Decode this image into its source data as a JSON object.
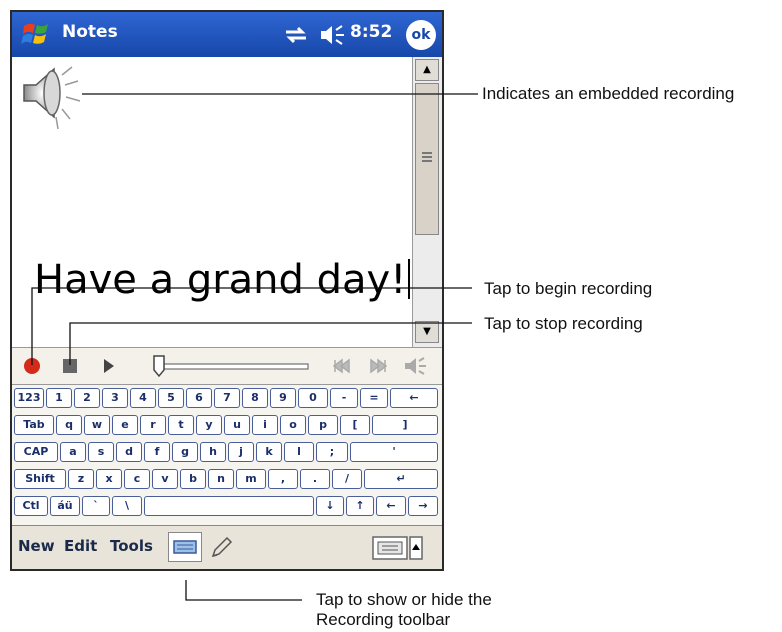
{
  "titlebar": {
    "app_title": "Notes",
    "time": "8:52",
    "ok_label": "ok"
  },
  "note": {
    "text": "Have a grand day!"
  },
  "keyboard": {
    "rows": [
      [
        "123",
        "1",
        "2",
        "3",
        "4",
        "5",
        "6",
        "7",
        "8",
        "9",
        "0",
        "-",
        "=",
        "←"
      ],
      [
        "Tab",
        "q",
        "w",
        "e",
        "r",
        "t",
        "y",
        "u",
        "i",
        "o",
        "p",
        "[",
        "]"
      ],
      [
        "CAP",
        "a",
        "s",
        "d",
        "f",
        "g",
        "h",
        "j",
        "k",
        "l",
        ";",
        "'"
      ],
      [
        "Shift",
        "z",
        "x",
        "c",
        "v",
        "b",
        "n",
        "m",
        ",",
        ".",
        "/",
        "↵"
      ],
      [
        "Ctl",
        "áü",
        "`",
        "\\",
        " ",
        "↓",
        "↑",
        "←",
        "→"
      ]
    ]
  },
  "menubar": {
    "new": "New",
    "edit": "Edit",
    "tools": "Tools"
  },
  "callouts": {
    "embedded": "Indicates an embedded recording",
    "begin": "Tap to begin recording",
    "stop": "Tap to stop recording",
    "toolbar_line1": "Tap to show or hide the",
    "toolbar_line2": "Recording toolbar"
  },
  "icons": {
    "start": "windows-flag-icon",
    "connectivity": "connectivity-icon",
    "volume": "speaker-icon",
    "recording": "embedded-recording-icon",
    "record": "record-icon",
    "stop": "stop-icon",
    "play": "play-icon",
    "rewind": "skip-back-icon",
    "forward": "skip-forward-icon",
    "recvolume": "volume-icon",
    "keyboard": "keyboard-icon",
    "pen": "pen-icon"
  },
  "colors": {
    "titlebar": "#1f56c4",
    "record": "#d42a1a",
    "key_text": "#1a2e6a"
  }
}
